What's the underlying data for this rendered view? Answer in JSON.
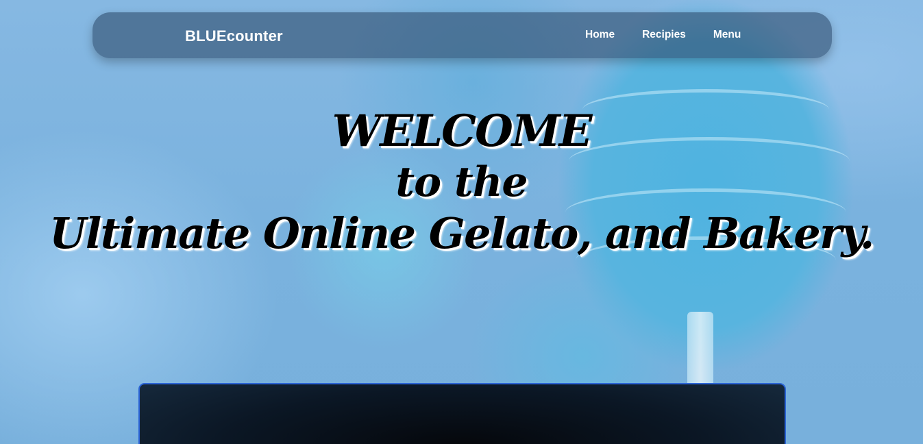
{
  "navbar": {
    "brand": "BLUEcounter",
    "links": [
      {
        "label": "Home"
      },
      {
        "label": "Recipies"
      },
      {
        "label": "Menu"
      }
    ]
  },
  "hero": {
    "line1": "WELCOME",
    "line2": "to the",
    "line3": "Ultimate Online Gelato, and Bakery."
  },
  "colors": {
    "navbar_bg": "#304e6e",
    "panel_border": "#2b64d6",
    "background": "#7db7df"
  }
}
